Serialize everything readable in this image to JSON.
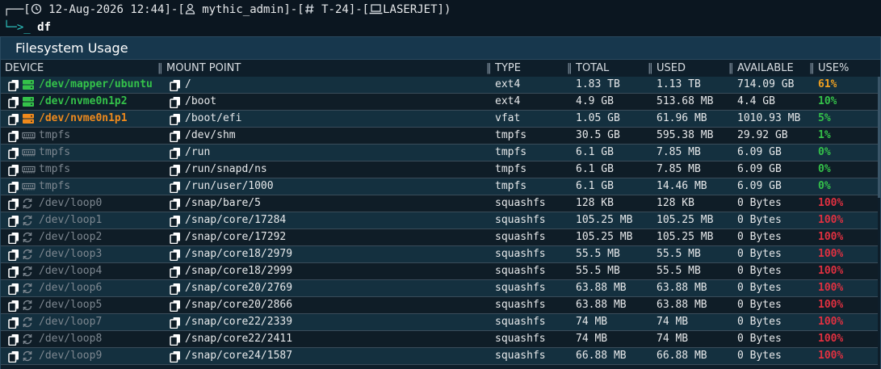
{
  "prompt": {
    "corner": "┌──",
    "time_open": "[",
    "time": "12-Aug-2026 12:44",
    "sep1": "]-[",
    "user": "mythic_admin",
    "sep2": "]-[",
    "tty": "T-24",
    "sep3": "]-[",
    "host": "LASERJET",
    "close": "])",
    "line2_prefix": "└─>_",
    "command": "df"
  },
  "panel": {
    "title": "Filesystem Usage"
  },
  "table": {
    "headers": {
      "device": "DEVICE",
      "mount": "MOUNT POINT",
      "type": "TYPE",
      "total": "TOTAL",
      "used": "USED",
      "available": "AVAILABLE",
      "use_pct": "USE%"
    },
    "rows": [
      {
        "device": "/dev/mapper/ubuntu",
        "kind": "disk",
        "style": "green",
        "mount": "/",
        "type": "ext4",
        "total": "1.83 TB",
        "used": "1.13 TB",
        "available": "714.09 GB",
        "pct": "61%",
        "pct_style": "orange"
      },
      {
        "device": "/dev/nvme0n1p2",
        "kind": "disk",
        "style": "green",
        "mount": "/boot",
        "type": "ext4",
        "total": "4.9 GB",
        "used": "513.68 MB",
        "available": "4.4 GB",
        "pct": "10%",
        "pct_style": "green"
      },
      {
        "device": "/dev/nvme0n1p1",
        "kind": "disk",
        "style": "orange",
        "mount": "/boot/efi",
        "type": "vfat",
        "total": "1.05 GB",
        "used": "61.96 MB",
        "available": "1010.93 MB",
        "pct": "5%",
        "pct_style": "green"
      },
      {
        "device": "tmpfs",
        "kind": "ram",
        "style": "grey",
        "mount": "/dev/shm",
        "type": "tmpfs",
        "total": "30.5 GB",
        "used": "595.38 MB",
        "available": "29.92 GB",
        "pct": "1%",
        "pct_style": "green"
      },
      {
        "device": "tmpfs",
        "kind": "ram",
        "style": "grey",
        "mount": "/run",
        "type": "tmpfs",
        "total": "6.1 GB",
        "used": "7.85 MB",
        "available": "6.09 GB",
        "pct": "0%",
        "pct_style": "green"
      },
      {
        "device": "tmpfs",
        "kind": "ram",
        "style": "grey",
        "mount": "/run/snapd/ns",
        "type": "tmpfs",
        "total": "6.1 GB",
        "used": "7.85 MB",
        "available": "6.09 GB",
        "pct": "0%",
        "pct_style": "green"
      },
      {
        "device": "tmpfs",
        "kind": "ram",
        "style": "grey",
        "mount": "/run/user/1000",
        "type": "tmpfs",
        "total": "6.1 GB",
        "used": "14.46 MB",
        "available": "6.09 GB",
        "pct": "0%",
        "pct_style": "green"
      },
      {
        "device": "/dev/loop0",
        "kind": "loop",
        "style": "grey",
        "mount": "/snap/bare/5",
        "type": "squashfs",
        "total": "128 KB",
        "used": "128 KB",
        "available": "0 Bytes",
        "pct": "100%",
        "pct_style": "red"
      },
      {
        "device": "/dev/loop1",
        "kind": "loop",
        "style": "grey",
        "mount": "/snap/core/17284",
        "type": "squashfs",
        "total": "105.25 MB",
        "used": "105.25 MB",
        "available": "0 Bytes",
        "pct": "100%",
        "pct_style": "red"
      },
      {
        "device": "/dev/loop2",
        "kind": "loop",
        "style": "grey",
        "mount": "/snap/core/17292",
        "type": "squashfs",
        "total": "105.25 MB",
        "used": "105.25 MB",
        "available": "0 Bytes",
        "pct": "100%",
        "pct_style": "red"
      },
      {
        "device": "/dev/loop3",
        "kind": "loop",
        "style": "grey",
        "mount": "/snap/core18/2979",
        "type": "squashfs",
        "total": "55.5 MB",
        "used": "55.5 MB",
        "available": "0 Bytes",
        "pct": "100%",
        "pct_style": "red"
      },
      {
        "device": "/dev/loop4",
        "kind": "loop",
        "style": "grey",
        "mount": "/snap/core18/2999",
        "type": "squashfs",
        "total": "55.5 MB",
        "used": "55.5 MB",
        "available": "0 Bytes",
        "pct": "100%",
        "pct_style": "red"
      },
      {
        "device": "/dev/loop6",
        "kind": "loop",
        "style": "grey",
        "mount": "/snap/core20/2769",
        "type": "squashfs",
        "total": "63.88 MB",
        "used": "63.88 MB",
        "available": "0 Bytes",
        "pct": "100%",
        "pct_style": "red"
      },
      {
        "device": "/dev/loop5",
        "kind": "loop",
        "style": "grey",
        "mount": "/snap/core20/2866",
        "type": "squashfs",
        "total": "63.88 MB",
        "used": "63.88 MB",
        "available": "0 Bytes",
        "pct": "100%",
        "pct_style": "red"
      },
      {
        "device": "/dev/loop7",
        "kind": "loop",
        "style": "grey",
        "mount": "/snap/core22/2339",
        "type": "squashfs",
        "total": "74 MB",
        "used": "74 MB",
        "available": "0 Bytes",
        "pct": "100%",
        "pct_style": "red"
      },
      {
        "device": "/dev/loop8",
        "kind": "loop",
        "style": "grey",
        "mount": "/snap/core22/2411",
        "type": "squashfs",
        "total": "74 MB",
        "used": "74 MB",
        "available": "0 Bytes",
        "pct": "100%",
        "pct_style": "red"
      },
      {
        "device": "/dev/loop9",
        "kind": "loop",
        "style": "grey",
        "mount": "/snap/core24/1587",
        "type": "squashfs",
        "total": "66.88 MB",
        "used": "66.88 MB",
        "available": "0 Bytes",
        "pct": "100%",
        "pct_style": "red"
      }
    ]
  },
  "icons": {
    "copy": "copy-icon",
    "disk": "drive-icon",
    "ram": "memory-icon",
    "loop": "loop-icon",
    "clock": "clock-icon",
    "user": "user-icon",
    "tty": "hash-icon",
    "host": "laptop-icon"
  },
  "colors": {
    "green": "#34c24a",
    "orange": "#f08a1c",
    "red": "#e03040",
    "cyan": "#2ec7c3",
    "header_bg": "#17374d"
  }
}
